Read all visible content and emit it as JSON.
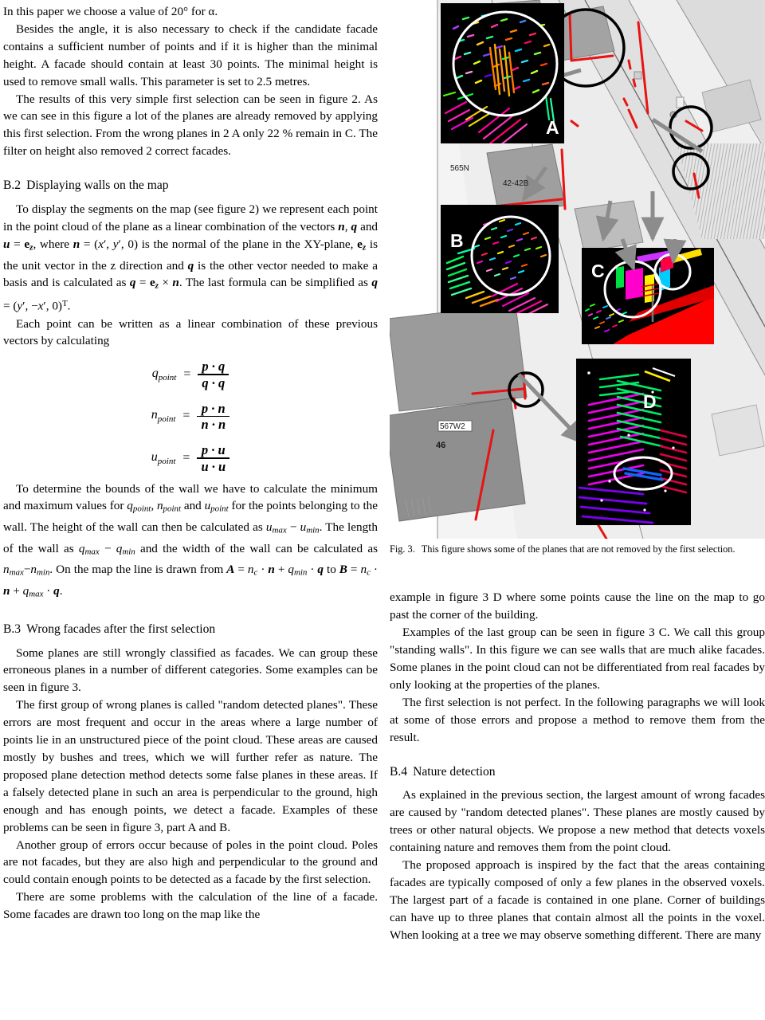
{
  "document": {
    "type": "academic-paper-page",
    "left_column": {
      "paragraphs": [
        "In this paper we choose a value of 20° for α.",
        "Besides the angle, it is also necessary to check if the candidate facade contains a sufficient number of points and if it is higher than the minimal height. A facade should contain at least 30 points. The minimal height is used to remove small walls. This parameter is set to 2.5 metres.",
        "The results of this very simple first selection can be seen in figure 2. As we can see in this figure a lot of the planes are already removed by applying this first selection. From the wrong planes in 2 A only 22 % remain in C. The filter on height also removed 2 correct facades."
      ],
      "section_b2": {
        "number": "B.2",
        "title": "Displaying walls on the map",
        "paragraphs": [
          "To display the segments on the map (see figure 2) we represent each point in the point cloud of the plane as a linear combination of the vectors n, q and u = e_z, where n = (x′, y′, 0) is the normal of the plane in the XY-plane, e_z is the unit vector in the z direction and q is the other vector needed to make a basis and is calculated as q = e_z × n. The last formula can be simplified as q = (y′, −x′, 0)^T.",
          "Each point can be written as a linear combination of these previous vectors by calculating"
        ]
      },
      "equations": [
        {
          "lhs": "q",
          "lhs_sub": "point",
          "numerator": "p · q",
          "denominator": "q · q"
        },
        {
          "lhs": "n",
          "lhs_sub": "point",
          "numerator": "p · n",
          "denominator": "n · n"
        },
        {
          "lhs": "u",
          "lhs_sub": "point",
          "numerator": "p · u",
          "denominator": "u · u"
        }
      ],
      "after_equations_paragraph": "To determine the bounds of the wall we have to calculate the minimum and maximum values for q_point, n_point and u_point for the points belonging to the wall. The height of the wall can then be calculated as u_max − u_min. The length of the wall as q_max − q_min and the width of the wall can be calculated as n_max−n_min. On the map the line is drawn from A = n_c · n + q_min · q to B = n_c · n + q_max · q.",
      "section_b3": {
        "number": "B.3",
        "title": "Wrong facades after the first selection",
        "paragraphs": [
          "Some planes are still wrongly classified as facades. We can group these erroneous planes in a number of different categories. Some examples can be seen in figure 3.",
          "The first group of wrong planes is called \"random detected planes\". These errors are most frequent and occur in the areas where a large number of points lie in an unstructured piece of the point cloud. These areas are caused mostly by bushes and trees, which we will further refer as nature. The proposed plane detection method detects some false planes in these areas. If a falsely detected plane in such an area is perpendicular to the ground, high enough and has enough points, we detect a facade. Examples of these problems can be seen in figure 3, part A and B.",
          "Another group of errors occur because of poles in the point cloud. Poles are not facades, but they are also high and perpendicular to the ground and could contain enough points to be detected as a facade by the first selection.",
          "There are some problems with the calculation of the line of a facade. Some facades are drawn too long on the map like the"
        ]
      }
    },
    "right_column": {
      "figure": {
        "caption_lead": "Fig. 3.",
        "caption_text": "This figure shows some of the planes that are not removed by the first selection.",
        "panel_letters": [
          "A",
          "B",
          "C",
          "D"
        ],
        "map_labels": [
          "565N",
          "42-42B",
          "567W2",
          "46"
        ],
        "colors": {
          "panel_background": "#000000",
          "map_background": "#f2f2f2",
          "building_fill": "#9a9a9a",
          "building_fill_light": "#d8d8d8",
          "facade_line": "#e81313",
          "highlight_circle_white": "#ffffff",
          "highlight_circle_black": "#000000",
          "arrow": "#8c8c8c",
          "ground_plane": "#ff0000"
        }
      },
      "paragraphs": [
        "example in figure 3 D where some points cause the line on the map to go past the corner of the building.",
        "Examples of the last group can be seen in figure 3 C. We call this group \"standing walls\". In this figure we can see walls that are much alike facades. Some planes in the point cloud can not be differentiated from real facades by only looking at the properties of the planes.",
        "The first selection is not perfect. In the following paragraphs we will look at some of those errors and propose a method to remove them from the result."
      ],
      "section_b4": {
        "number": "B.4",
        "title": "Nature detection",
        "paragraphs": [
          "As explained in the previous section, the largest amount of wrong facades are caused by \"random detected planes\". These planes are mostly caused by trees or other natural objects. We propose a new method that detects voxels containing nature and removes them from the point cloud.",
          "The proposed approach is inspired by the fact that the areas containing facades are typically composed of only a few planes in the observed voxels. The largest part of a facade is contained in one plane. Corner of buildings can have up to three planes that contain almost all the points in the voxel. When looking at a tree we may observe something different. There are many"
        ]
      }
    }
  }
}
